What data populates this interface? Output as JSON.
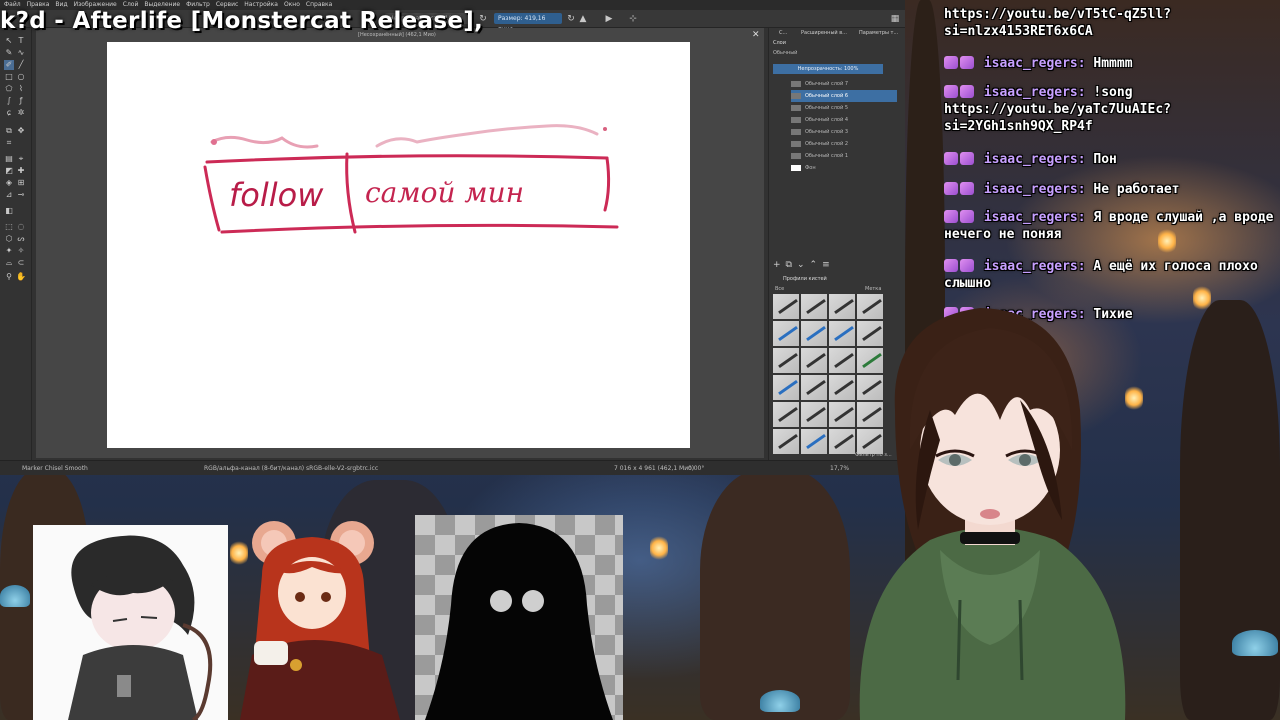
{
  "stream": {
    "now_playing": "k?d - Afterlife [Monstercat Release],"
  },
  "krita": {
    "menu": [
      "Файл",
      "Правка",
      "Вид",
      "Изображение",
      "Слой",
      "Выделение",
      "Фильтр",
      "Сервис",
      "Настройка",
      "Окно",
      "Справка"
    ],
    "toolbar": {
      "opacity_field": "Непрозрачность: 100%",
      "size_field": "Размер: 419,16 пикс."
    },
    "document_title": "[Несохранённый]  (462,1 Мио)",
    "statusbar": {
      "brush": "Marker Chisel Smooth",
      "color_profile": "RGB/альфа-канал (8-бит/канал)  sRGB-elle-V2-srgbtrc.icc",
      "dimensions": "7 016 x 4 961 (462,1 Мио)",
      "rotation": "0,00°",
      "zoom": "17,7%"
    },
    "layers_docker": {
      "tabs": [
        "С...",
        "Расширенный в...",
        "Параметры т..."
      ],
      "title": "Слои",
      "blend_mode": "Обычный",
      "opacity": "Непрозрачность: 100%",
      "layers": [
        {
          "name": "Обычный слой 7",
          "active": false
        },
        {
          "name": "Обычный слой 6",
          "active": true
        },
        {
          "name": "Обычный слой 5",
          "active": false
        },
        {
          "name": "Обычный слой 4",
          "active": false
        },
        {
          "name": "Обычный слой 3",
          "active": false
        },
        {
          "name": "Обычный слой 2",
          "active": false
        },
        {
          "name": "Обычный слой 1",
          "active": false
        },
        {
          "name": "Фон",
          "active": false
        }
      ]
    },
    "presets_docker": {
      "title": "Профили кистей",
      "tag": "Все",
      "tag_label": "Метка",
      "filter": "Фильтр по з..."
    },
    "canvas_text": {
      "word1": "follow",
      "word2": "самой мин"
    }
  },
  "chat": {
    "messages": [
      {
        "user": "",
        "text": "https://youtu.be/vT5tC-qZ5ll?si=nlzx4153RET6x6CA"
      },
      {
        "user": "isaac_regers:",
        "text": "Hmmmm"
      },
      {
        "user": "isaac_regers:",
        "text": "!song https://youtu.be/yaTc7UuAIEc?si=2YGh1snh9QX_RP4f"
      },
      {
        "user": "isaac_regers:",
        "text": "Пон"
      },
      {
        "user": "isaac_regers:",
        "text": "Не работает"
      },
      {
        "user": "isaac_regers:",
        "text": "Я вроде слушай ,а вроде нечего не поняя"
      },
      {
        "user": "isaac_regers:",
        "text": "А ещё их голоса плохо слышно"
      },
      {
        "user": "isaac_regers:",
        "text": "Тихие"
      }
    ]
  }
}
